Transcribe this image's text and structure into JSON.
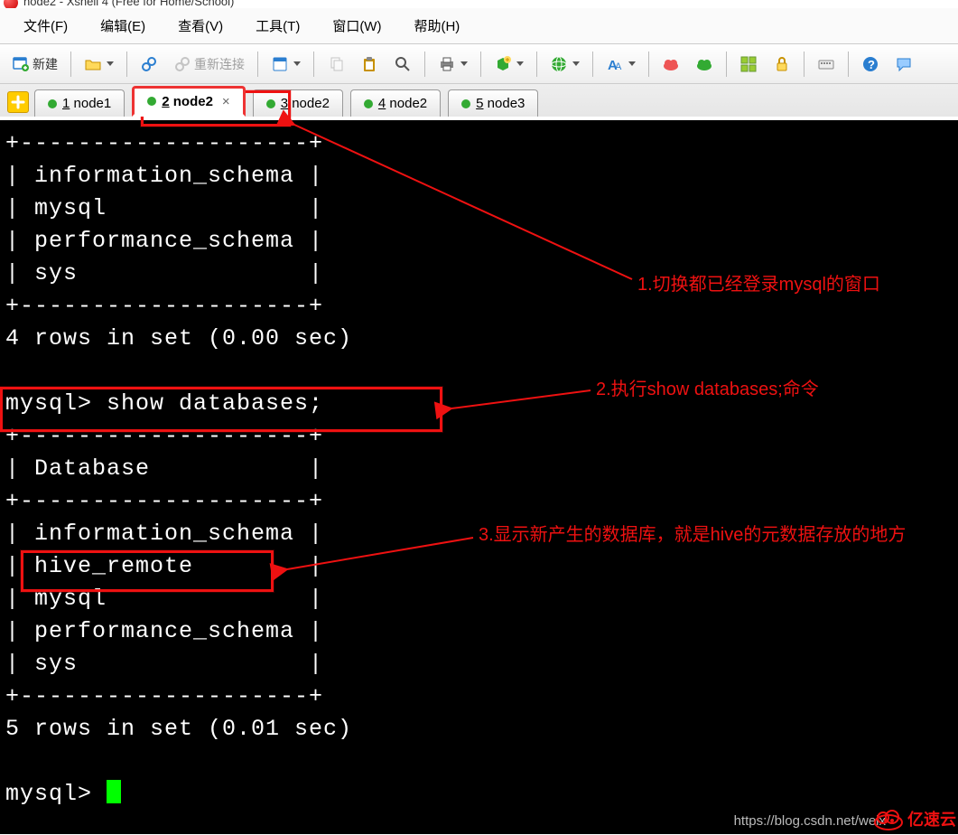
{
  "window": {
    "title": "node2 - Xshell 4 (Free for Home/School)"
  },
  "menu": {
    "file": "文件(F)",
    "edit": "编辑(E)",
    "view": "查看(V)",
    "tools": "工具(T)",
    "window": "窗口(W)",
    "help": "帮助(H)"
  },
  "toolbar": {
    "new_label": "新建",
    "reconnect_label": "重新连接"
  },
  "tabs": [
    {
      "label": "1 node1"
    },
    {
      "label": "2 node2"
    },
    {
      "label": "3 node2"
    },
    {
      "label": "4 node2"
    },
    {
      "label": "5 node3"
    }
  ],
  "terminal_lines": [
    "+--------------------+",
    "| information_schema |",
    "| mysql              |",
    "| performance_schema |",
    "| sys                |",
    "+--------------------+",
    "4 rows in set (0.00 sec)",
    "",
    "mysql> show databases;",
    "+--------------------+",
    "| Database           |",
    "+--------------------+",
    "| information_schema |",
    "| hive_remote        |",
    "| mysql              |",
    "| performance_schema |",
    "| sys                |",
    "+--------------------+",
    "5 rows in set (0.01 sec)",
    "",
    "mysql> "
  ],
  "annotations": {
    "note1": "1.切换都已经登录mysql的窗口",
    "note2": "2.执行show databases;命令",
    "note3": "3.显示新产生的数据库，就是hive的元数据存放的地方"
  },
  "watermark": "https://blog.csdn.net/weix",
  "brand": "亿速云"
}
